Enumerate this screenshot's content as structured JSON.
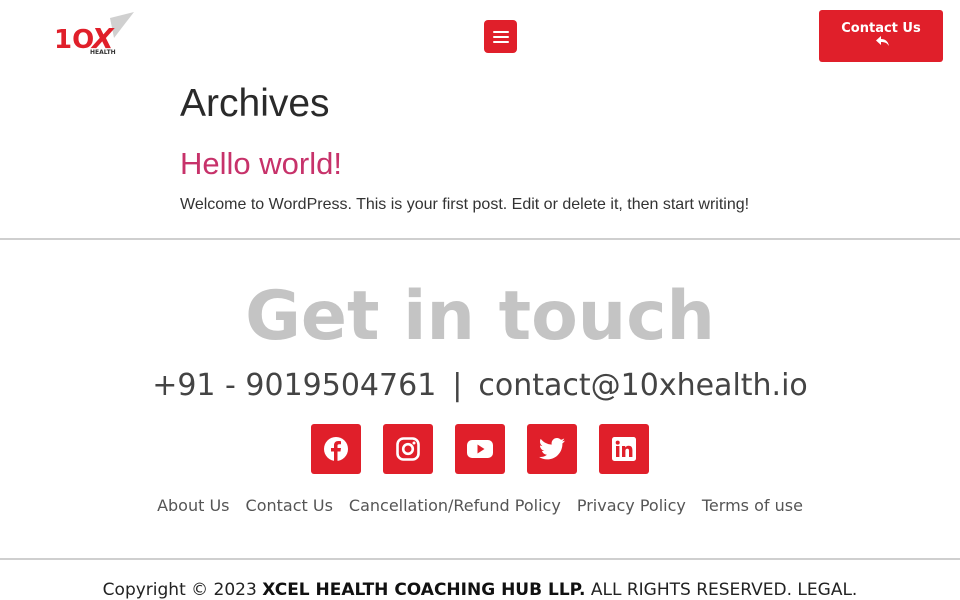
{
  "header": {
    "logo_text": "10X",
    "logo_subtext": "HEALTH",
    "menu_icon": "hamburger-menu-icon",
    "contact_button": {
      "label": "Contact Us",
      "icon": "reply-arrow-icon"
    }
  },
  "main": {
    "archives_title": "Archives",
    "post": {
      "title": "Hello world!",
      "excerpt": "Welcome to WordPress. This is your first post. Edit or delete it, then start writing!"
    }
  },
  "footer": {
    "heading": "Get in touch",
    "phone": "+91 - 9019504761",
    "separator": "|",
    "email": "contact@10xhealth.io",
    "social": [
      {
        "name": "facebook-icon"
      },
      {
        "name": "instagram-icon"
      },
      {
        "name": "youtube-icon"
      },
      {
        "name": "twitter-icon"
      },
      {
        "name": "linkedin-icon"
      }
    ],
    "links": [
      "About Us",
      "Contact Us",
      "Cancellation/Refund Policy",
      "Privacy Policy",
      "Terms of use"
    ],
    "copyright": {
      "prefix": "Copyright © 2023",
      "company": "XCEL HEALTH COACHING HUB LLP.",
      "suffix": "ALL RIGHTS RESERVED. LEGAL."
    }
  },
  "colors": {
    "brand_red": "#e01f2a",
    "post_title": "#c7326a",
    "heading_grey": "#c4c4c4"
  }
}
